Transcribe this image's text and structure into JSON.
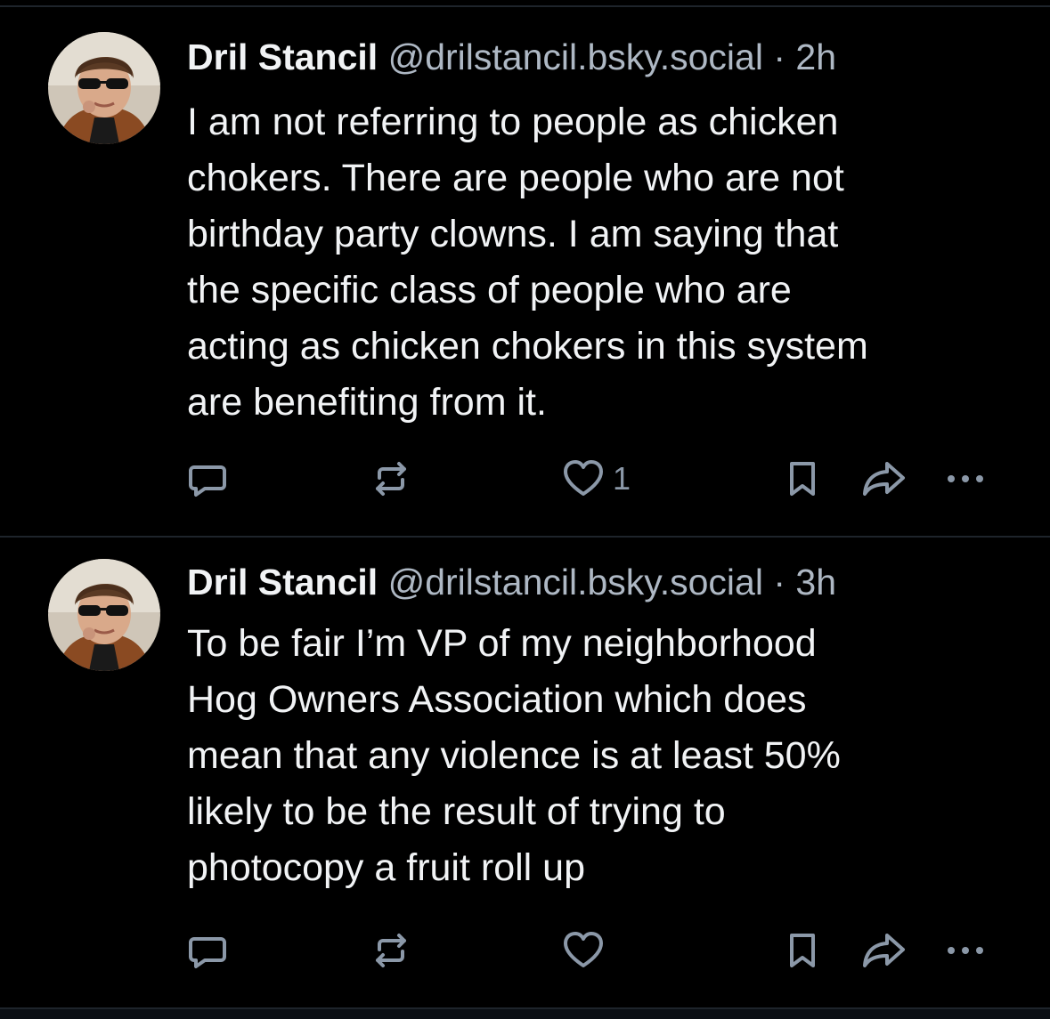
{
  "posts": [
    {
      "author": {
        "display_name": "Dril Stancil",
        "handle": "@drilstancil.bsky.social"
      },
      "separator": "·",
      "time": "2h",
      "text": "I am not referring to people as chicken\nchokers. There are people who are not\nbirthday party clowns. I am saying that\nthe specific class of people who are\nacting as chicken chokers in this system\nare benefiting from it.",
      "like_count": "1",
      "icons": [
        "reply-icon",
        "repost-icon",
        "like-icon",
        "bookmark-icon",
        "share-icon",
        "more-icon"
      ]
    },
    {
      "author": {
        "display_name": "Dril Stancil",
        "handle": "@drilstancil.bsky.social"
      },
      "separator": "·",
      "time": "3h",
      "text": "To be fair I’m VP of my neighborhood\nHog Owners Association which does\nmean that any violence is at least 50%\nlikely to be the result of trying to\nphotocopy a fruit roll up",
      "like_count": "",
      "icons": [
        "reply-icon",
        "repost-icon",
        "like-icon",
        "bookmark-icon",
        "share-icon",
        "more-icon"
      ]
    }
  ],
  "colors": {
    "background": "#000000",
    "text": "#f1f3f5",
    "secondary_text": "#aeb8c4",
    "icon": "#8b98a8",
    "divider": "#1e242b"
  }
}
